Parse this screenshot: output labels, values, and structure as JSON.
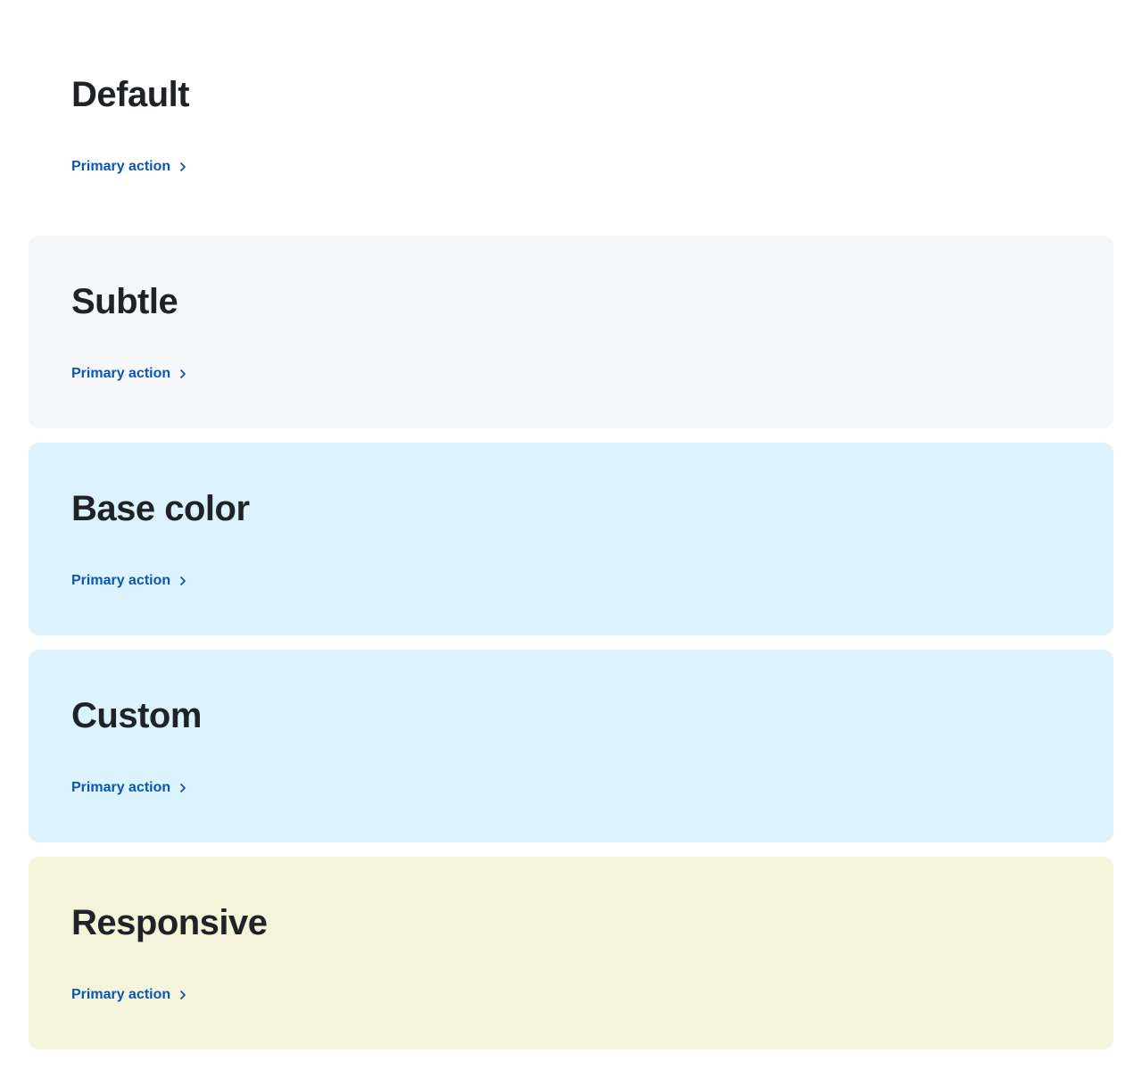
{
  "cards": [
    {
      "variant": "default",
      "title": "Default",
      "action_label": "Primary action",
      "background": "#ffffff",
      "action_icon": "chevron-right-icon"
    },
    {
      "variant": "subtle",
      "title": "Subtle",
      "action_label": "Primary action",
      "background": "#f5f7f9",
      "action_icon": "chevron-right-icon"
    },
    {
      "variant": "base-color",
      "title": "Base color",
      "action_label": "Primary action",
      "background": "#dcf2fc",
      "action_icon": "chevron-right-icon"
    },
    {
      "variant": "custom",
      "title": "Custom",
      "action_label": "Primary action",
      "background": "#dcf2fc",
      "action_icon": "chevron-right-icon"
    },
    {
      "variant": "responsive",
      "title": "Responsive",
      "action_label": "Primary action",
      "background": "#f4f4da",
      "action_icon": "chevron-right-icon"
    }
  ],
  "colors": {
    "title_text": "#1f2327",
    "action_link": "#0b57b0"
  }
}
